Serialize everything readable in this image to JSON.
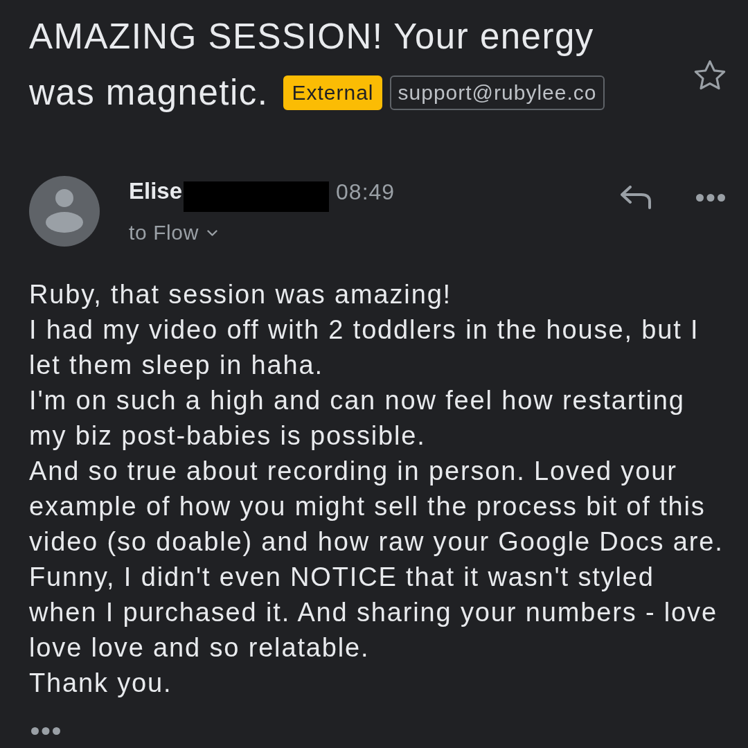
{
  "subject": {
    "title_lines": [
      "AMAZING SESSION! Your energy",
      "was magnetic."
    ],
    "labels": [
      {
        "kind": "warning",
        "text": "External"
      },
      {
        "kind": "outline",
        "text": "support@rubylee.co"
      }
    ],
    "starred": false
  },
  "message": {
    "sender": "Elise",
    "sender_redacted": true,
    "time": "08:49",
    "recipient": "to Flow"
  },
  "body": [
    {
      "lines": [
        "Ruby, that session was amazing!"
      ]
    },
    {
      "lines": [
        "I had my video off with 2 toddlers in the house, but I",
        "let them sleep in haha."
      ]
    },
    {
      "lines": [
        "I'm on such a high and can now feel how restarting",
        "my biz post-babies is possible."
      ]
    },
    {
      "lines": [
        "And so true about recording in person. Loved your",
        "example of how you might sell the process bit of this",
        "video (so doable) and how raw your Google Docs are.",
        "Funny, I didn't even NOTICE that it wasn't styled",
        "when I purchased it. And sharing your numbers - love",
        "love love and so relatable."
      ]
    },
    {
      "lines": [
        "Thank you."
      ]
    }
  ],
  "trimmed_content": true
}
